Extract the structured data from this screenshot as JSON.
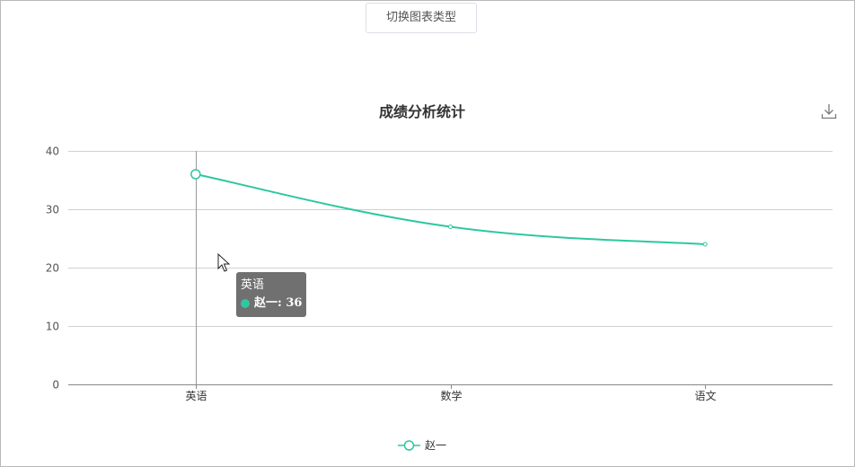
{
  "toolbar": {
    "switch_label": "切换图表类型"
  },
  "chart_data": {
    "type": "line",
    "title": "成绩分析统计",
    "categories": [
      "英语",
      "数学",
      "语文"
    ],
    "series": [
      {
        "name": "赵一",
        "values": [
          36,
          27,
          24
        ],
        "color": "#2ec7a0",
        "smooth": true
      }
    ],
    "ylim": [
      0,
      40
    ],
    "yticks": [
      0,
      10,
      20,
      30,
      40
    ],
    "grid": true,
    "legend": "bottom-center"
  },
  "tooltip": {
    "category": "英语",
    "series_name": "赵一",
    "value_text": "赵一: 36"
  },
  "icons": {
    "download": "download-icon",
    "cursor": "arrow-cursor-icon"
  },
  "colors": {
    "series": "#2ec7a0",
    "grid": "#d0d0d0",
    "axis": "#888888",
    "tooltip_bg": "#575757"
  }
}
